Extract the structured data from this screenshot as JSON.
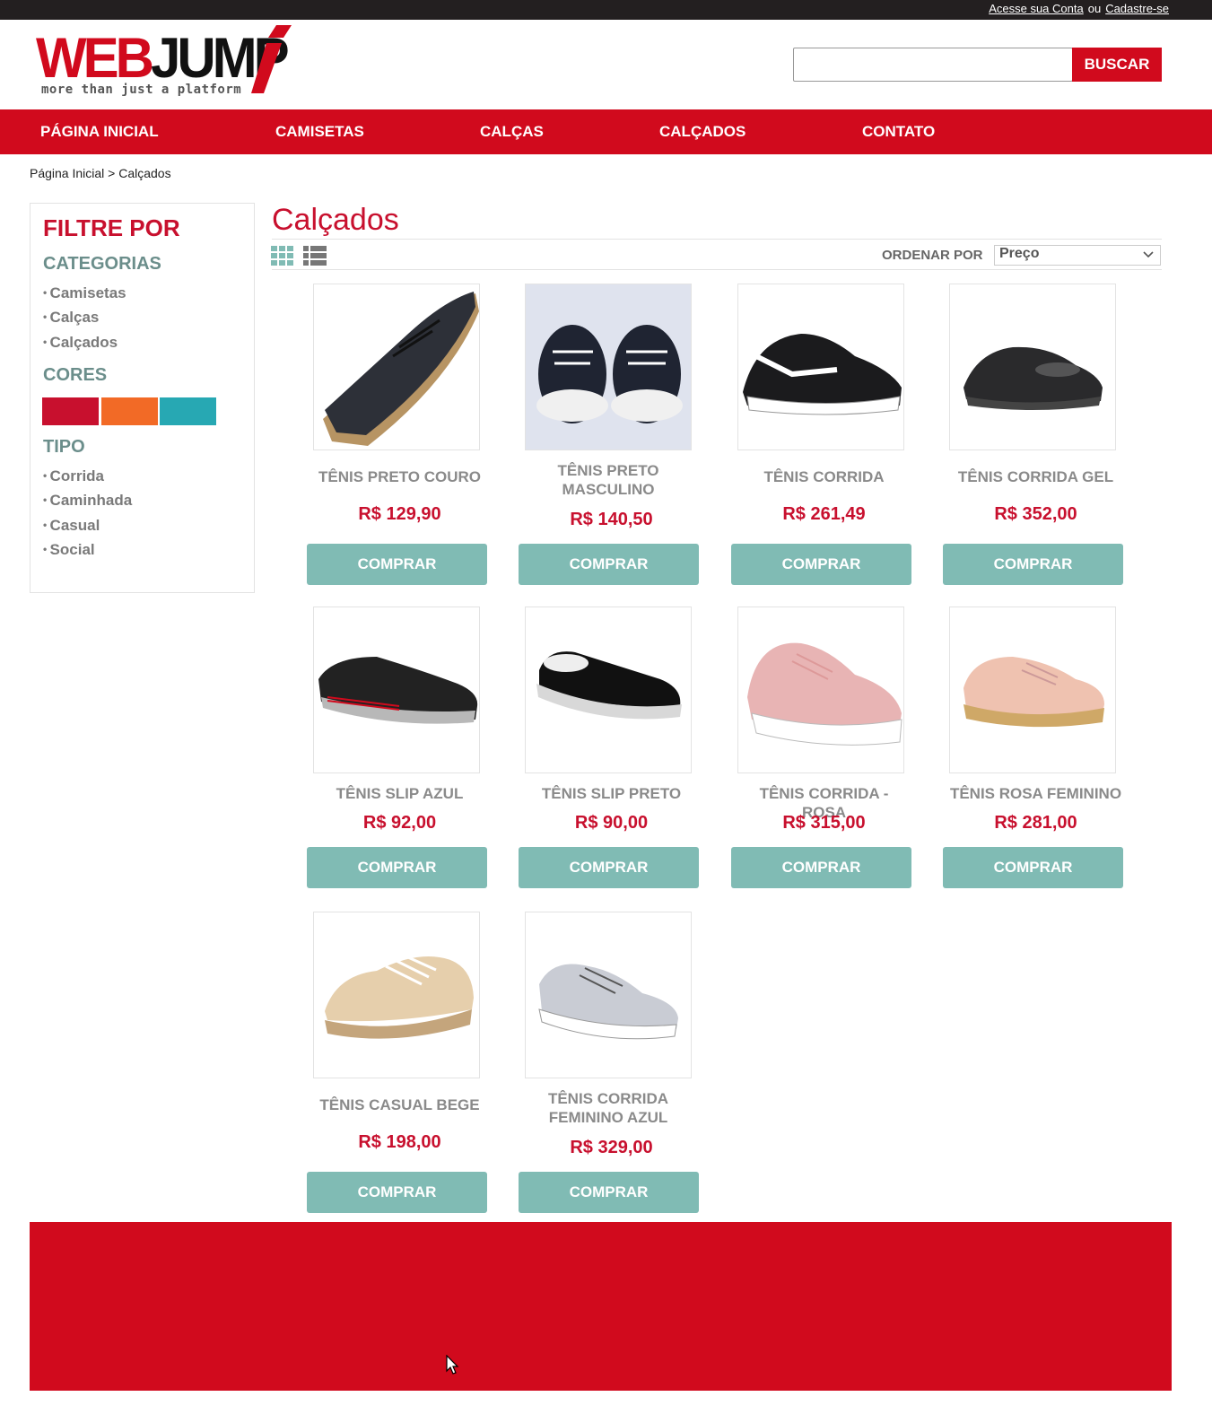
{
  "topbar": {
    "login_label": "Acesse sua Conta",
    "or_label": "ou",
    "signup_label": "Cadastre-se"
  },
  "brand": {
    "name_part1": "WEB",
    "name_part2": "JUMP",
    "tagline": "more than just a platform",
    "primary_color": "#d10a1d"
  },
  "search": {
    "value": "",
    "placeholder": "",
    "button_label": "BUSCAR"
  },
  "nav": {
    "items": [
      {
        "label": "PÁGINA INICIAL"
      },
      {
        "label": "CAMISETAS"
      },
      {
        "label": "CALÇAS"
      },
      {
        "label": "CALÇADOS"
      },
      {
        "label": "CONTATO"
      }
    ]
  },
  "breadcrumb": {
    "text": "Página Inicial > Calçados"
  },
  "sidebar": {
    "title": "FILTRE POR",
    "categories_title": "CATEGORIAS",
    "categories": [
      {
        "label": "Camisetas"
      },
      {
        "label": "Calças"
      },
      {
        "label": "Calçados"
      }
    ],
    "colors_title": "CORES",
    "colors": [
      {
        "name": "red",
        "hex": "#c8102e"
      },
      {
        "name": "orange",
        "hex": "#f26a26"
      },
      {
        "name": "teal",
        "hex": "#27a8b3"
      }
    ],
    "type_title": "TIPO",
    "types": [
      {
        "label": "Corrida"
      },
      {
        "label": "Caminhada"
      },
      {
        "label": "Casual"
      },
      {
        "label": "Social"
      }
    ]
  },
  "main": {
    "title": "Calçados",
    "view_icons": [
      "grid-view-icon",
      "list-view-icon"
    ],
    "sort_label": "ORDENAR POR",
    "sort_value": "Preço"
  },
  "products": [
    {
      "name": "TÊNIS PRETO COURO",
      "price": "R$ 129,90",
      "buy_label": "COMPRAR",
      "image": "black-leather-sneaker"
    },
    {
      "name": "TÊNIS PRETO MASCULINO",
      "price": "R$ 140,50",
      "buy_label": "COMPRAR",
      "image": "black-canvas-pair"
    },
    {
      "name": "TÊNIS CORRIDA",
      "price": "R$ 261,49",
      "buy_label": "COMPRAR",
      "image": "black-running-shoe"
    },
    {
      "name": "TÊNIS CORRIDA GEL",
      "price": "R$ 352,00",
      "buy_label": "COMPRAR",
      "image": "black-patent-shoe"
    },
    {
      "name": "TÊNIS SLIP AZUL",
      "price": "R$ 92,00",
      "buy_label": "COMPRAR",
      "image": "black-slip-on"
    },
    {
      "name": "TÊNIS SLIP PRETO",
      "price": "R$ 90,00",
      "buy_label": "COMPRAR",
      "image": "black-canvas-slip"
    },
    {
      "name": "TÊNIS CORRIDA - ROSA",
      "price": "R$ 315,00",
      "buy_label": "COMPRAR",
      "image": "pink-running-shoe"
    },
    {
      "name": "TÊNIS ROSA FEMININO",
      "price": "R$ 281,00",
      "buy_label": "COMPRAR",
      "image": "pink-espadrille"
    },
    {
      "name": "TÊNIS CASUAL BEGE",
      "price": "R$ 198,00",
      "buy_label": "COMPRAR",
      "image": "beige-casual-shoe"
    },
    {
      "name": "TÊNIS CORRIDA FEMININO AZUL",
      "price": "R$ 329,00",
      "buy_label": "COMPRAR",
      "image": "grey-knit-runner"
    }
  ]
}
